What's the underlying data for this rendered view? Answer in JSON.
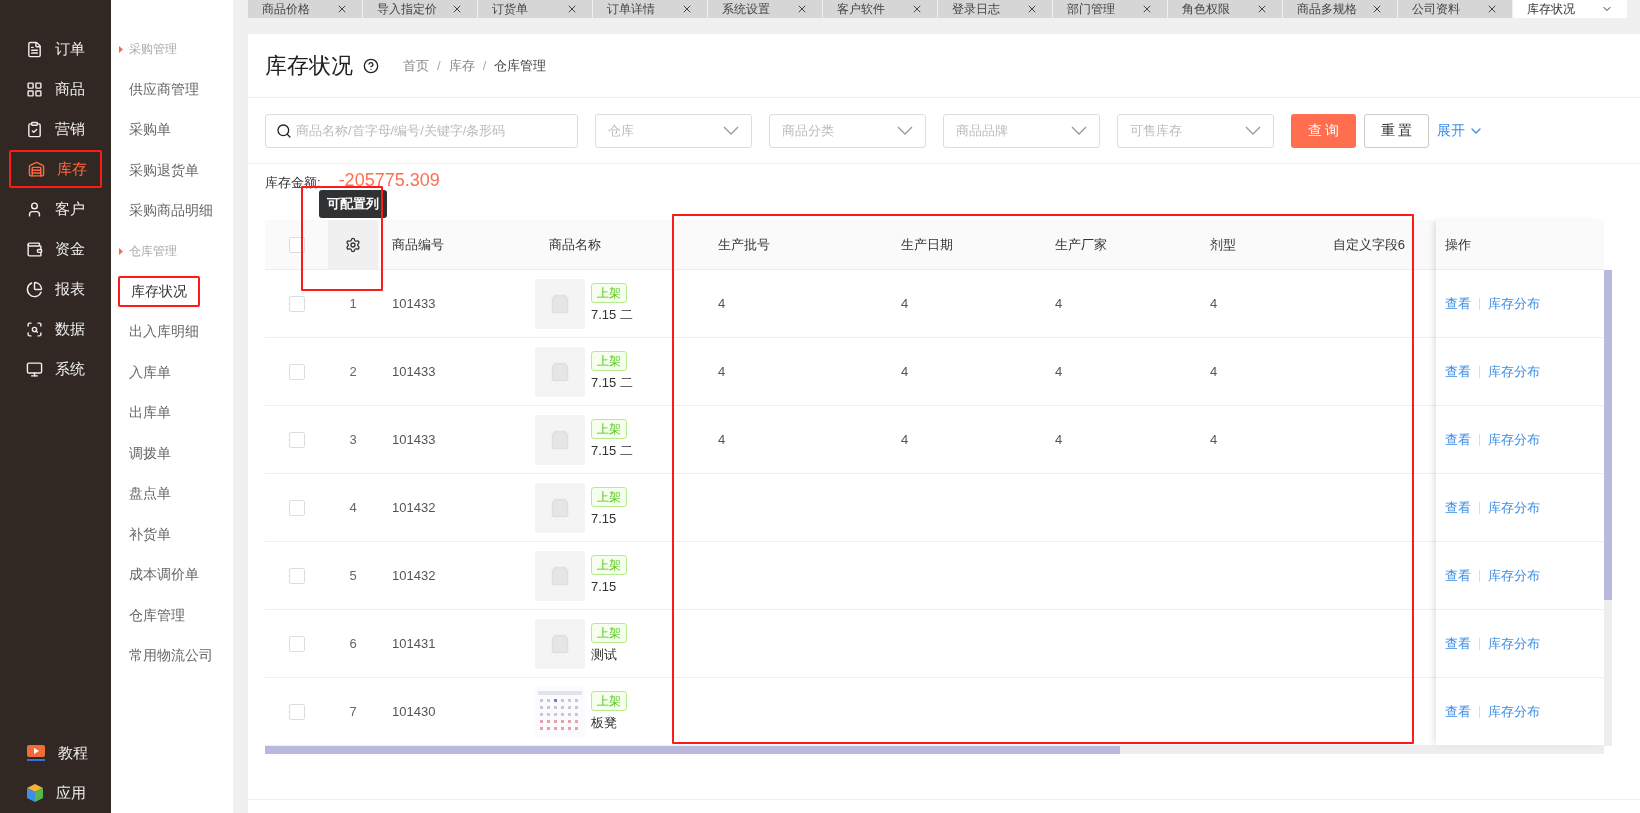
{
  "nav": [
    {
      "label": "订单",
      "selected": false,
      "highlighted": false
    },
    {
      "label": "商品",
      "selected": false,
      "highlighted": false
    },
    {
      "label": "营销",
      "selected": false,
      "highlighted": false
    },
    {
      "label": "库存",
      "selected": true,
      "highlighted": true
    },
    {
      "label": "客户",
      "selected": false,
      "highlighted": false
    },
    {
      "label": "资金",
      "selected": false,
      "highlighted": false
    },
    {
      "label": "报表",
      "selected": false,
      "highlighted": false
    },
    {
      "label": "数据",
      "selected": false,
      "highlighted": false
    },
    {
      "label": "系统",
      "selected": false,
      "highlighted": false
    }
  ],
  "nav_bottom": [
    {
      "label": "教程"
    },
    {
      "label": "应用"
    }
  ],
  "submenu": [
    {
      "kind": "group",
      "label": "采购管理"
    },
    {
      "kind": "item",
      "label": "供应商管理",
      "selected": false,
      "highlighted": false
    },
    {
      "kind": "item",
      "label": "采购单",
      "selected": false,
      "highlighted": false
    },
    {
      "kind": "item",
      "label": "采购退货单",
      "selected": false,
      "highlighted": false
    },
    {
      "kind": "item",
      "label": "采购商品明细",
      "selected": false,
      "highlighted": false
    },
    {
      "kind": "group",
      "label": "仓库管理"
    },
    {
      "kind": "item",
      "label": "库存状况",
      "selected": true,
      "highlighted": true
    },
    {
      "kind": "item",
      "label": "出入库明细",
      "selected": false,
      "highlighted": false
    },
    {
      "kind": "item",
      "label": "入库单",
      "selected": false,
      "highlighted": false
    },
    {
      "kind": "item",
      "label": "出库单",
      "selected": false,
      "highlighted": false
    },
    {
      "kind": "item",
      "label": "调拨单",
      "selected": false,
      "highlighted": false
    },
    {
      "kind": "item",
      "label": "盘点单",
      "selected": false,
      "highlighted": false
    },
    {
      "kind": "item",
      "label": "补货单",
      "selected": false,
      "highlighted": false
    },
    {
      "kind": "item",
      "label": "成本调价单",
      "selected": false,
      "highlighted": false
    },
    {
      "kind": "item",
      "label": "仓库管理",
      "selected": false,
      "highlighted": false
    },
    {
      "kind": "item",
      "label": "常用物流公司",
      "selected": false,
      "highlighted": false
    }
  ],
  "tabs": [
    {
      "label": "商品价格",
      "selected": false
    },
    {
      "label": "导入指定价",
      "selected": false
    },
    {
      "label": "订货单",
      "selected": false
    },
    {
      "label": "订单详情",
      "selected": false
    },
    {
      "label": "系统设置",
      "selected": false
    },
    {
      "label": "客户软件",
      "selected": false
    },
    {
      "label": "登录日志",
      "selected": false
    },
    {
      "label": "部门管理",
      "selected": false
    },
    {
      "label": "角色权限",
      "selected": false
    },
    {
      "label": "商品多规格",
      "selected": false
    },
    {
      "label": "公司资料",
      "selected": false
    },
    {
      "label": "库存状况",
      "selected": true
    }
  ],
  "page": {
    "title": "库存状况",
    "breadcrumb": [
      "首页",
      "库存",
      "仓库管理"
    ],
    "breadcrumb_separator": "/"
  },
  "filters": {
    "search_placeholder": "商品名称/首字母/编号/关键字/条形码",
    "selects": [
      "仓库",
      "商品分类",
      "商品品牌",
      "可售库存"
    ],
    "query": "查 询",
    "reset": "重 置",
    "expand": "展开"
  },
  "summary": {
    "label": "库存金额:",
    "value": "-205775.309"
  },
  "tooltip": "可配置列",
  "table": {
    "settings_framed": true,
    "select_all": false,
    "columns": [
      {
        "label": "商品编号",
        "framed": false
      },
      {
        "label": "商品名称",
        "framed": false
      },
      {
        "label": "生产批号",
        "framed": true
      },
      {
        "label": "生产日期",
        "framed": true
      },
      {
        "label": "生产厂家",
        "framed": true
      },
      {
        "label": "剂型",
        "framed": true
      },
      {
        "label": "自定义字段6",
        "framed": true
      },
      {
        "label": "操作",
        "framed": false
      }
    ],
    "rows": [
      {
        "index": "1",
        "checked": false,
        "code": "101433",
        "thumbnail": {
          "kind": "placeholder"
        },
        "status": "上架",
        "name": "7.15 二",
        "batch": "4",
        "date": "4",
        "maker": "4",
        "form": "4",
        "actions": [
          "查看",
          "库存分布"
        ]
      },
      {
        "index": "2",
        "checked": false,
        "code": "101433",
        "thumbnail": {
          "kind": "placeholder"
        },
        "status": "上架",
        "name": "7.15 二",
        "batch": "4",
        "date": "4",
        "maker": "4",
        "form": "4",
        "actions": [
          "查看",
          "库存分布"
        ]
      },
      {
        "index": "3",
        "checked": false,
        "code": "101433",
        "thumbnail": {
          "kind": "placeholder"
        },
        "status": "上架",
        "name": "7.15 二",
        "batch": "4",
        "date": "4",
        "maker": "4",
        "form": "4",
        "actions": [
          "查看",
          "库存分布"
        ]
      },
      {
        "index": "4",
        "checked": false,
        "code": "101432",
        "thumbnail": {
          "kind": "placeholder"
        },
        "status": "上架",
        "name": "7.15",
        "actions": [
          "查看",
          "库存分布"
        ]
      },
      {
        "index": "5",
        "checked": false,
        "code": "101432",
        "thumbnail": {
          "kind": "placeholder"
        },
        "status": "上架",
        "name": "7.15",
        "actions": [
          "查看",
          "库存分布"
        ]
      },
      {
        "index": "6",
        "checked": false,
        "code": "101431",
        "thumbnail": {
          "kind": "placeholder"
        },
        "status": "上架",
        "name": "测试",
        "actions": [
          "查看",
          "库存分布"
        ]
      },
      {
        "index": "7",
        "checked": false,
        "code": "101430",
        "thumbnail": {
          "kind": "picture"
        },
        "status": "上架",
        "name": "板凳",
        "actions": [
          "查看",
          "库存分布"
        ]
      }
    ]
  }
}
